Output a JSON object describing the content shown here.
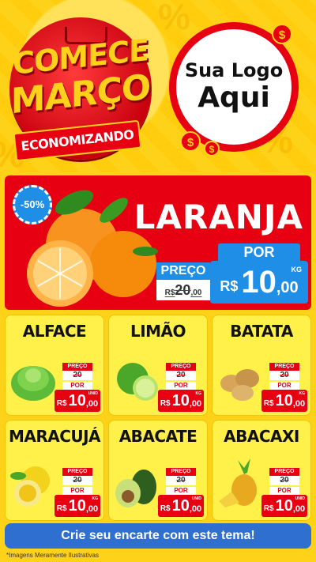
{
  "header": {
    "badge_line1": "COMECE",
    "badge_line2": "MARÇO",
    "ribbon": "ECONOMIZANDO",
    "logo_line1": "Sua Logo",
    "logo_line2": "Aqui",
    "coin_symbol": "$"
  },
  "hero": {
    "discount": "-50%",
    "product": "LARANJA",
    "old_label": "PREÇO",
    "old_currency": "R$",
    "old_int": "20",
    "old_dec": ",00",
    "new_label": "POR",
    "new_currency": "R$",
    "new_int": "10",
    "new_dec": ",00",
    "unit": "KG"
  },
  "products": [
    {
      "name": "ALFACE",
      "old_label": "PREÇO",
      "old_price": "20",
      "por": "POR",
      "currency": "R$",
      "int": "10",
      "dec": ",00",
      "unit": "UNID"
    },
    {
      "name": "LIMÃO",
      "old_label": "PREÇO",
      "old_price": "20",
      "por": "POR",
      "currency": "R$",
      "int": "10",
      "dec": ",00",
      "unit": "KG"
    },
    {
      "name": "BATATA",
      "old_label": "PREÇO",
      "old_price": "20",
      "por": "POR",
      "currency": "R$",
      "int": "10",
      "dec": ",00",
      "unit": "KG"
    },
    {
      "name": "MARACUJÁ",
      "old_label": "PREÇO",
      "old_price": "20",
      "por": "POR",
      "currency": "R$",
      "int": "10",
      "dec": ",00",
      "unit": "KG"
    },
    {
      "name": "ABACATE",
      "old_label": "PREÇO",
      "old_price": "20",
      "por": "POR",
      "currency": "R$",
      "int": "10",
      "dec": ",00",
      "unit": "UNID"
    },
    {
      "name": "ABACAXI",
      "old_label": "PREÇO",
      "old_price": "20",
      "por": "POR",
      "currency": "R$",
      "int": "10",
      "dec": ",00",
      "unit": "UNID"
    }
  ],
  "cta": "Crie seu encarte com este tema!",
  "disclaimer": "*Imagens Meramente Ilustrativas",
  "colors": {
    "red": "#e60012",
    "yellow": "#ffd21a",
    "blue": "#1e8ee6",
    "cta_blue": "#2e6fcf"
  }
}
